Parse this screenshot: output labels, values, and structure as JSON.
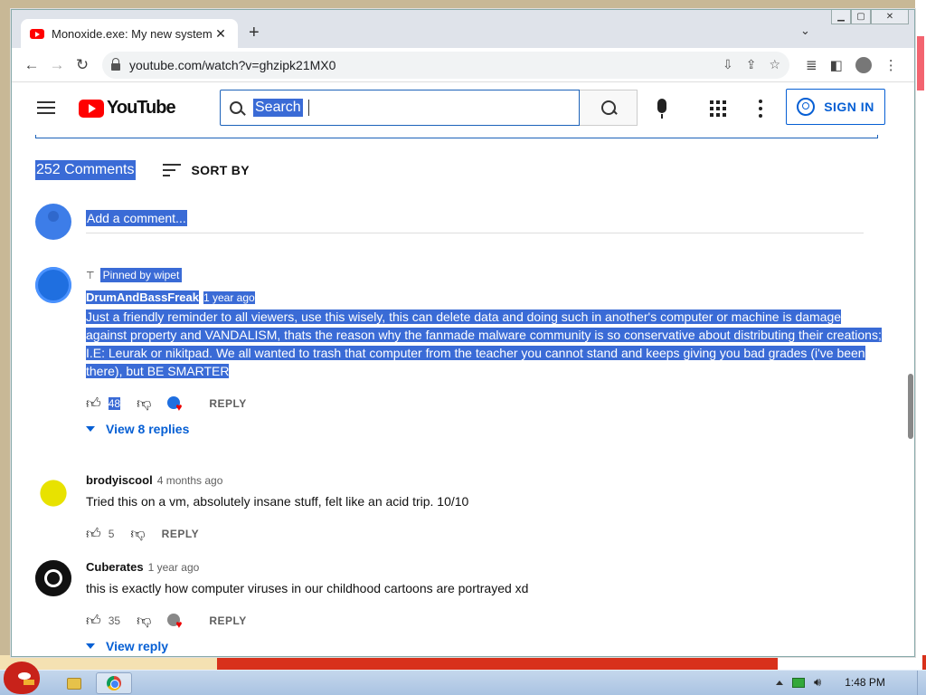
{
  "browser": {
    "tab_title": "Monoxide.exe: My new system",
    "tab_close": "✕",
    "new_tab": "+",
    "url": "youtube.com/watch?v=ghzipk21MX0"
  },
  "youtube": {
    "logo_text": "YouTube",
    "search_value": "Search",
    "sign_in": "SIGN IN"
  },
  "comments": {
    "count_label": "252 Comments",
    "sort_label": "SORT BY",
    "add_placeholder": "Add a comment...",
    "reply_label": "REPLY",
    "items": [
      {
        "pinned": "Pinned by wipet",
        "author": "DrumAndBassFreak",
        "time": "1 year ago",
        "text": "Just a friendly reminder to all viewers, use this wisely, this can delete data and doing such in another's computer or machine is damage against property and VANDALISM, thats the reason why the fanmade malware community is so conservative about distributing their creations; I.E: Leurak or nikitpad. We all wanted to trash that computer from the teacher you cannot stand and keeps giving you bad grades (i've been there), but BE SMARTER",
        "likes": "48",
        "view_replies": "View 8 replies"
      },
      {
        "author": "brodyiscool",
        "time": "4 months ago",
        "text": "Tried this on a vm, absolutely insane stuff, felt like an acid trip. 10/10",
        "likes": "5"
      },
      {
        "author": "Cuberates",
        "time": "1 year ago",
        "text": "this is exactly how computer viruses in our childhood cartoons are portrayed xd",
        "likes": "35",
        "view_replies": "View reply"
      }
    ]
  },
  "taskbar": {
    "clock": "1:48 PM"
  },
  "colors": {
    "selection": "#3a6bd6",
    "link_blue": "#065fd4",
    "youtube_red": "#ff0000"
  }
}
